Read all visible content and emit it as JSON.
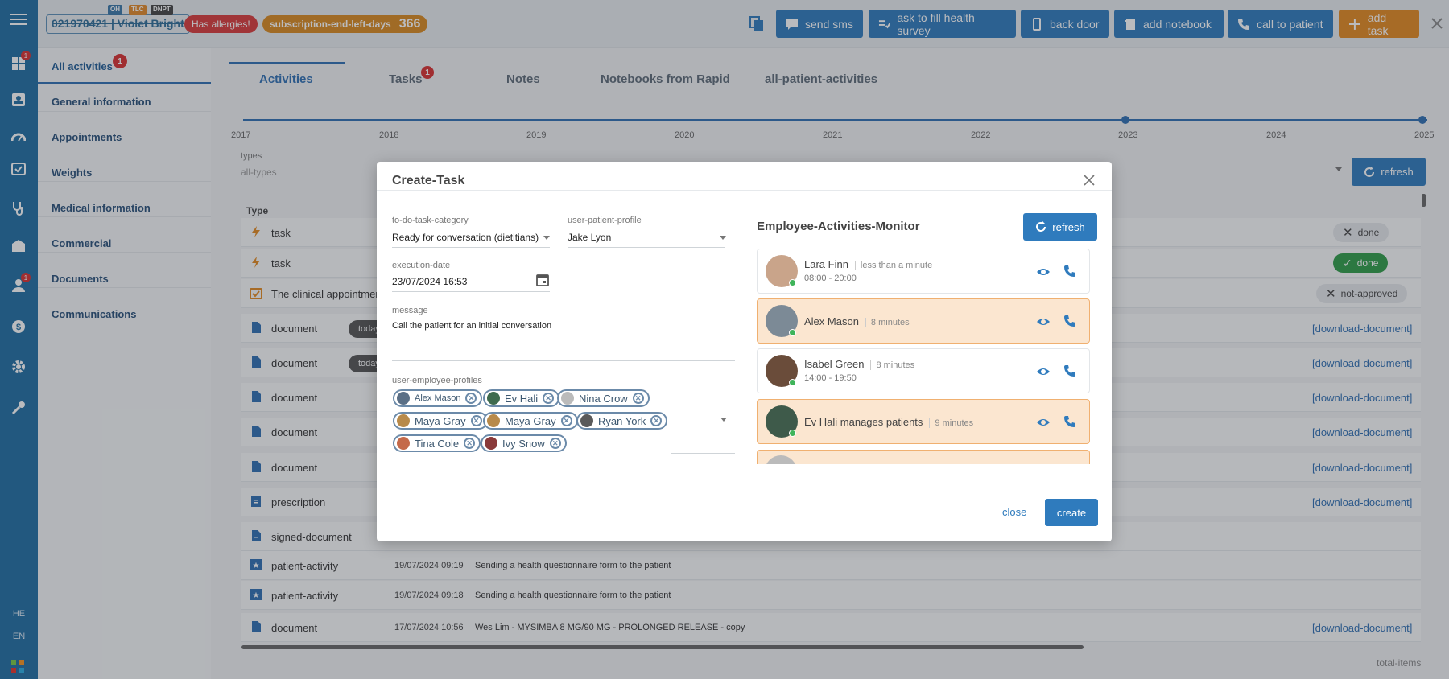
{
  "header": {
    "patient_id": "021970421 | Violet Bright",
    "mini_tags": [
      "OH",
      "TLC",
      "DNPT"
    ],
    "allergy_badge": "Has allergies!",
    "subscription_label": "subscription-end-left-days",
    "subscription_days": "366",
    "buttons": {
      "send_sms": "send sms",
      "health_survey": "ask to fill health survey",
      "back_door": "back door",
      "add_notebook": "add notebook",
      "call_patient": "call to patient",
      "add_task": "add task"
    }
  },
  "iconbar": {
    "badge_1": "1",
    "badge_2": "1",
    "lang_he": "HE",
    "lang_en": "EN"
  },
  "sidenav": {
    "items": [
      {
        "label": "All activities",
        "badge": "1"
      },
      {
        "label": "General information"
      },
      {
        "label": "Appointments"
      },
      {
        "label": "Weights"
      },
      {
        "label": "Medical information"
      },
      {
        "label": "Commercial"
      },
      {
        "label": "Documents"
      },
      {
        "label": "Communications"
      }
    ]
  },
  "main": {
    "tabs": [
      {
        "label": "Activities"
      },
      {
        "label": "Tasks",
        "badge": "1"
      },
      {
        "label": "Notes"
      },
      {
        "label": "Notebooks from Rapid"
      },
      {
        "label": "all-patient-activities"
      }
    ],
    "years": [
      "2017",
      "2018",
      "2019",
      "2020",
      "2021",
      "2022",
      "2023",
      "2024",
      "2025"
    ],
    "types_label": "types",
    "types_placeholder": "all-types",
    "refresh": "refresh",
    "type_header": "Type",
    "today": "today",
    "download": "[download-document]",
    "rows": [
      {
        "type": "task",
        "status": "done"
      },
      {
        "type": "task",
        "status": "done"
      },
      {
        "type": "The clinical appointment",
        "status": "not-approved"
      },
      {
        "type": "document"
      },
      {
        "type": "document"
      },
      {
        "type": "document"
      },
      {
        "type": "document"
      },
      {
        "type": "document"
      },
      {
        "type": "prescription"
      },
      {
        "type": "signed-document"
      },
      {
        "type": "patient-activity",
        "date": "19/07/2024 09:19",
        "desc": "Sending a health questionnaire form to the patient"
      },
      {
        "type": "patient-activity",
        "date": "19/07/2024 09:18",
        "desc": "Sending a health questionnaire form to the patient"
      },
      {
        "type": "document",
        "date": "17/07/2024 10:56",
        "desc": "Wes Lim - MYSIMBA 8 MG/90 MG - PROLONGED RELEASE - copy"
      }
    ],
    "total_items": "total-items"
  },
  "modal": {
    "title": "Create-Task",
    "category_label": "to-do-task-category",
    "category_value": "Ready for conversation (dietitians)",
    "patient_label": "user-patient-profile",
    "patient_value": "Jake Lyon",
    "date_label": "execution-date",
    "date_value": "23/07/2024 16:53",
    "message_label": "message",
    "message_value": "Call the patient for an initial conversation",
    "employees_label": "user-employee-profiles",
    "employees": [
      "Alex Mason",
      "Ev Hali",
      "Nina Crow",
      "Maya Gray",
      "Maya Gray",
      "Ryan York",
      "Tina Cole",
      "Ivy Snow"
    ],
    "monitor_title": "Employee-Activities-Monitor",
    "monitor_refresh": "refresh",
    "monitor": [
      {
        "name": "Lara Finn",
        "time": "less than a minute",
        "hours": "08:00 - 20:00"
      },
      {
        "name": "Alex Mason",
        "time": "8 minutes"
      },
      {
        "name": "Isabel Green",
        "time": "8 minutes",
        "hours": "14:00 - 19:50"
      },
      {
        "name": "Ev Hali manages patients",
        "time": "9 minutes"
      }
    ],
    "close": "close",
    "create": "create"
  }
}
